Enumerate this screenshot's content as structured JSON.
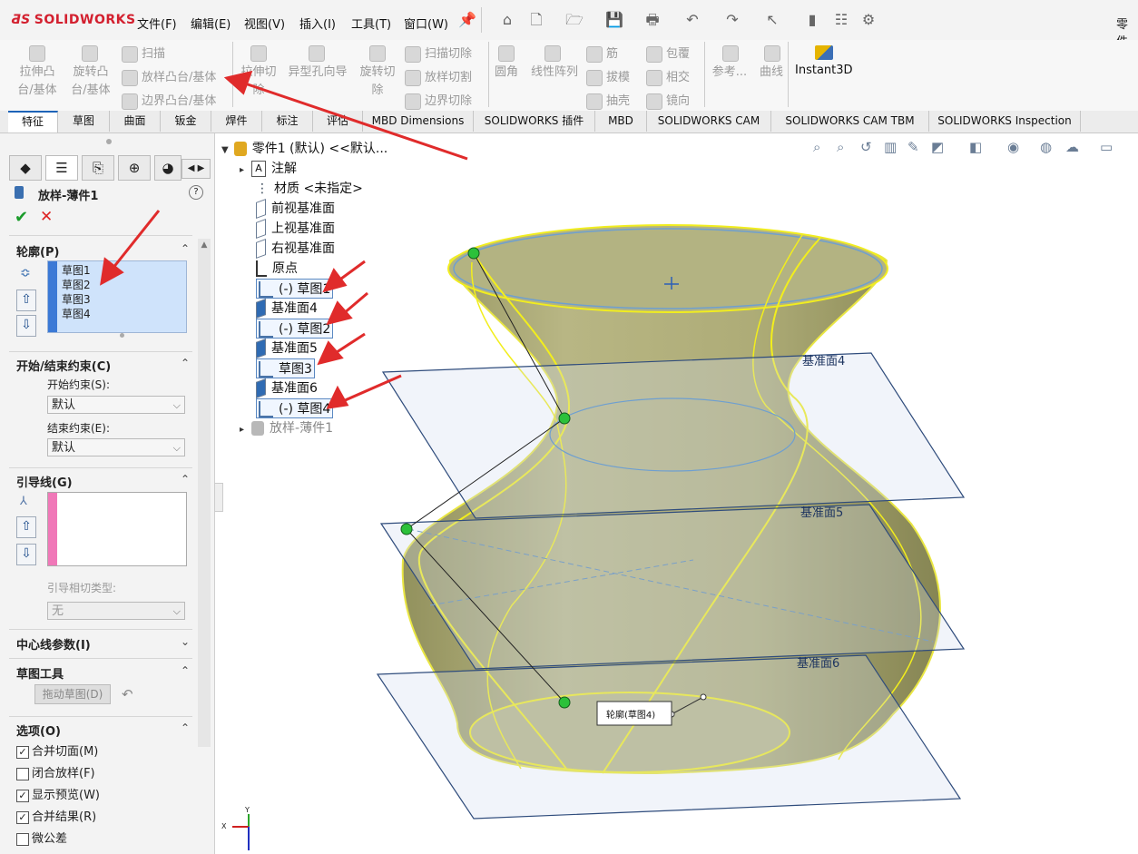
{
  "app": {
    "logo": "SOLIDWORKS",
    "doc_title_partial": "零件"
  },
  "menu": [
    "文件(F)",
    "编辑(E)",
    "视图(V)",
    "插入(I)",
    "工具(T)",
    "窗口(W)"
  ],
  "commands": {
    "extrude_boss": [
      "拉伸凸",
      "台/基体"
    ],
    "revolve_boss": [
      "旋转凸",
      "台/基体"
    ],
    "sweep": "扫描",
    "loft": "放样凸台/基体",
    "boundary": "边界凸台/基体",
    "extrude_cut": [
      "拉伸切",
      "除"
    ],
    "hole_wizard": "异型孔向导",
    "revolve_cut": [
      "旋转切",
      "除"
    ],
    "sweep_cut": "扫描切除",
    "loft_cut": "放样切割",
    "boundary_cut": "边界切除",
    "fillet": "圆角",
    "linear_pattern": "线性阵列",
    "rib": "筋",
    "draft": "拔模",
    "shell": "抽壳",
    "wrap": "包覆",
    "intersect": "相交",
    "mirror": "镜向",
    "reference": "参考...",
    "curves": "曲线",
    "instant3d": "Instant3D"
  },
  "tabs": [
    "特征",
    "草图",
    "曲面",
    "钣金",
    "焊件",
    "标注",
    "评估",
    "MBD Dimensions",
    "SOLIDWORKS 插件",
    "MBD",
    "SOLIDWORKS CAM",
    "SOLIDWORKS CAM TBM",
    "SOLIDWORKS Inspection"
  ],
  "panel": {
    "title": "放样-薄件1",
    "help": "?",
    "profiles_header": "轮廓(P)",
    "profiles": [
      "草图1",
      "草图2",
      "草图3",
      "草图4"
    ],
    "constraints_header": "开始/结束约束(C)",
    "start_label": "开始约束(S):",
    "start_value": "默认",
    "end_label": "结束约束(E):",
    "end_value": "默认",
    "guides_header": "引导线(G)",
    "guide_tangency_label": "引导相切类型:",
    "guide_tangency_value": "无",
    "centerline_header": "中心线参数(I)",
    "sketch_tools_header": "草图工具",
    "drag_sketch": "拖动草图(D)",
    "options_header": "选项(O)",
    "options": [
      {
        "label": "合并切面(M)",
        "checked": true
      },
      {
        "label": "闭合放样(F)",
        "checked": false
      },
      {
        "label": "显示预览(W)",
        "checked": true
      },
      {
        "label": "合并结果(R)",
        "checked": true
      },
      {
        "label": "微公差",
        "checked": false
      }
    ]
  },
  "tree": {
    "root": "零件1 (默认) <<默认...",
    "items": [
      "注解",
      "材质 <未指定>",
      "前视基准面",
      "上视基准面",
      "右视基准面",
      "原点",
      "(-) 草图1",
      "基准面4",
      "(-) 草图2",
      "基准面5",
      "草图3",
      "基准面6",
      "(-) 草图4",
      "放样-薄件1"
    ]
  },
  "viewport": {
    "plane_labels": [
      "基准面4",
      "基准面5",
      "基准面6"
    ],
    "callout": "轮廓(草图4)",
    "triad": {
      "x": "X",
      "y": "Y"
    }
  },
  "colors": {
    "accent": "#1d63b8",
    "surface": "#a7a465",
    "highlight": "#f3ef1e",
    "annotation_red": "#e02b2b",
    "logo_red": "#d3202f"
  }
}
